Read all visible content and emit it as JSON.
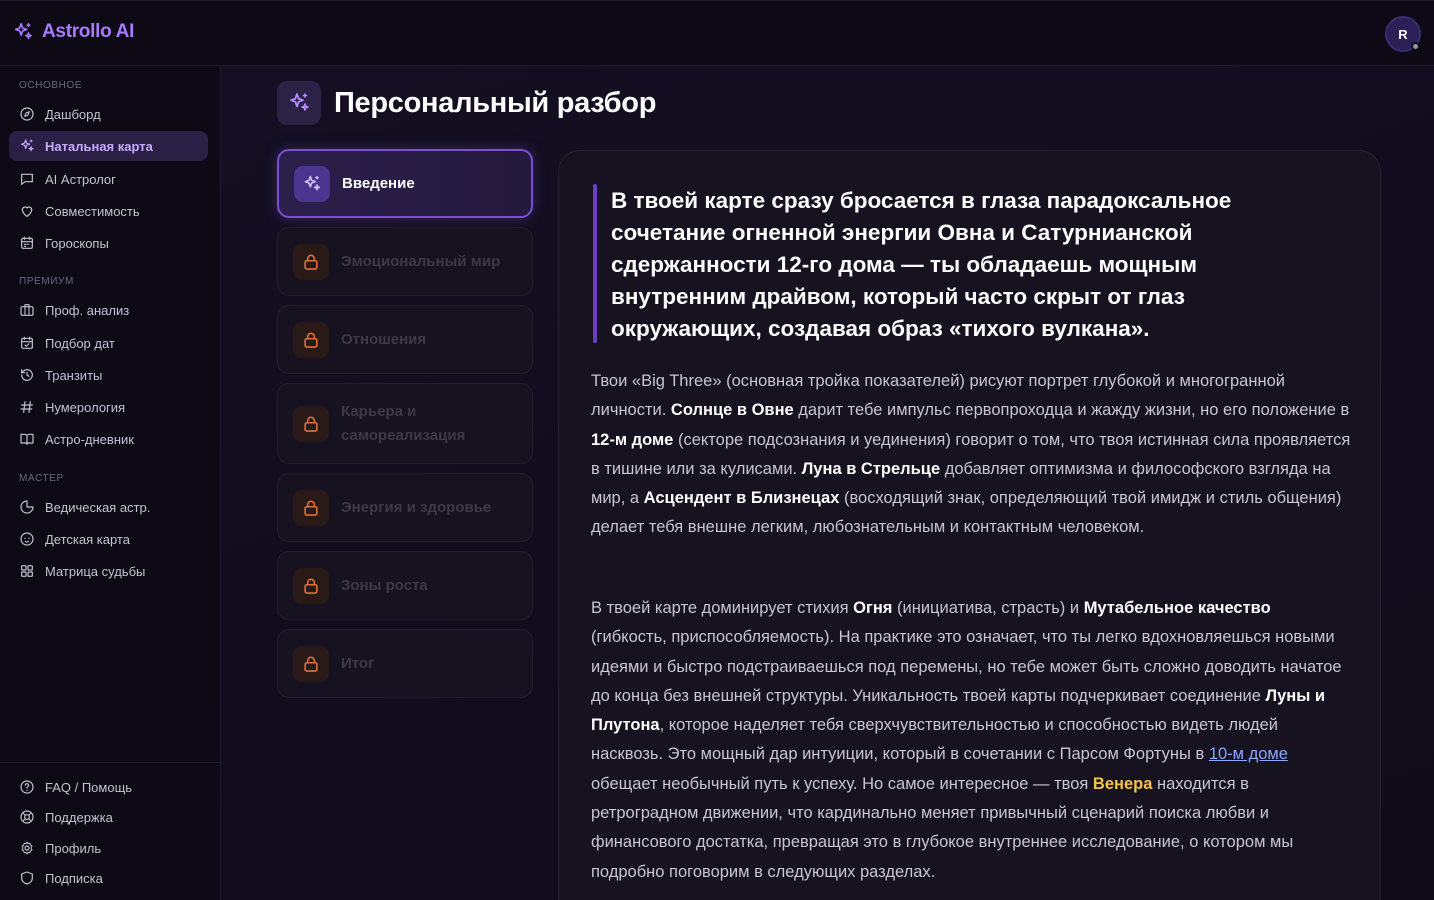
{
  "app": {
    "name": "Astrollo AI",
    "user_initial": "R"
  },
  "sidebar": {
    "sections": [
      {
        "label": "ОСНОВНОЕ",
        "items": [
          {
            "label": "Дашборд",
            "icon": "compass-icon"
          },
          {
            "label": "Натальная карта",
            "icon": "sparkles-icon",
            "active": true
          },
          {
            "label": "AI Астролог",
            "icon": "chat-icon"
          },
          {
            "label": "Совместимость",
            "icon": "heart-icon"
          },
          {
            "label": "Гороскопы",
            "icon": "calendar-icon"
          }
        ]
      },
      {
        "label": "ПРЕМИУМ",
        "items": [
          {
            "label": "Проф. анализ",
            "icon": "briefcase-icon"
          },
          {
            "label": "Подбор дат",
            "icon": "calendar-check-icon"
          },
          {
            "label": "Транзиты",
            "icon": "history-icon"
          },
          {
            "label": "Нумерология",
            "icon": "hash-icon"
          },
          {
            "label": "Астро-дневник",
            "icon": "book-icon"
          }
        ]
      },
      {
        "label": "МАСТЕР",
        "items": [
          {
            "label": "Ведическая астр.",
            "icon": "moon-icon"
          },
          {
            "label": "Детская карта",
            "icon": "baby-icon"
          },
          {
            "label": "Матрица судьбы",
            "icon": "grid-icon"
          }
        ]
      }
    ],
    "footer": [
      {
        "label": "FAQ / Помощь",
        "icon": "help-circle-icon"
      },
      {
        "label": "Поддержка",
        "icon": "lifebuoy-icon"
      },
      {
        "label": "Профиль",
        "icon": "settings-icon"
      },
      {
        "label": "Подписка",
        "icon": "shield-icon"
      }
    ]
  },
  "page": {
    "title": "Персональный разбор"
  },
  "reading_sections": [
    {
      "label": "Введение",
      "active": true,
      "locked": false
    },
    {
      "label": "Эмоциональный мир",
      "locked": true
    },
    {
      "label": "Отношения",
      "locked": true
    },
    {
      "label": "Карьера и самореализация",
      "locked": true
    },
    {
      "label": "Энергия и здоровье",
      "locked": true
    },
    {
      "label": "Зоны роста",
      "locked": true
    },
    {
      "label": "Итог",
      "locked": true
    }
  ],
  "content": {
    "quote": "В твоей карте сразу бросается в глаза парадоксальное сочетание огненной энергии Овна и Сатурнианской сдержанности 12-го дома — ты обладаешь мощным внутренним драйвом, который часто скрыт от глаз окружающих, создавая образ «тихого вулкана».",
    "p1": [
      {
        "t": "Твои «Big Three» (основная тройка показателей) рисуют портрет глубокой и многогранной личности. "
      },
      {
        "t": "Солнце в Овне",
        "s": "b"
      },
      {
        "t": " дарит тебе импульс первопроходца и жажду жизни, но его положение в "
      },
      {
        "t": "12-м доме",
        "s": "b"
      },
      {
        "t": " (секторе подсознания и уединения) говорит о том, что твоя истинная сила проявляется в тишине или за кулисами. "
      },
      {
        "t": "Луна в Стрельце",
        "s": "b"
      },
      {
        "t": " добавляет оптимизма и философского взгляда на мир, а "
      },
      {
        "t": "Асцендент в Близнецах",
        "s": "b"
      },
      {
        "t": " (восходящий знак, определяющий твой имидж и стиль общения) делает тебя внешне легким, любознательным и контактным человеком."
      }
    ],
    "p2": [
      {
        "t": "В твоей карте доминирует стихия "
      },
      {
        "t": "Огня",
        "s": "b"
      },
      {
        "t": " (инициатива, страсть) и "
      },
      {
        "t": "Мутабельное качество",
        "s": "b"
      },
      {
        "t": " (гибкость, приспособляемость). На практике это означает, что ты легко вдохновляешься новыми идеями и быстро подстраиваешься под перемены, но тебе может быть сложно доводить начатое до конца без внешней структуры. Уникальность твоей карты подчеркивает соединение "
      },
      {
        "t": "Луны и Плутона",
        "s": "b"
      },
      {
        "t": ", которое наделяет тебя сверхчувствительностью и способностью видеть людей насквозь. Это мощный дар интуиции, который в сочетании с Парсом Фортуны в "
      },
      {
        "t": "10-м доме",
        "s": "link"
      },
      {
        "t": " обещает необычный путь к успеху. Но самое интересное — твоя "
      },
      {
        "t": "Венера",
        "s": "gold"
      },
      {
        "t": " находится в ретроградном движении, что кардинально меняет привычный сценарий поиска любви и финансового достатка, превращая это в глубокое внутреннее исследование, о котором мы подробно поговорим в следующих разделах."
      }
    ]
  },
  "colors": {
    "accent": "#a77bff",
    "active_border": "#7a4fd6",
    "gold": "#f5c34a",
    "link": "#8aa7ff",
    "lock": "#e0703a"
  }
}
